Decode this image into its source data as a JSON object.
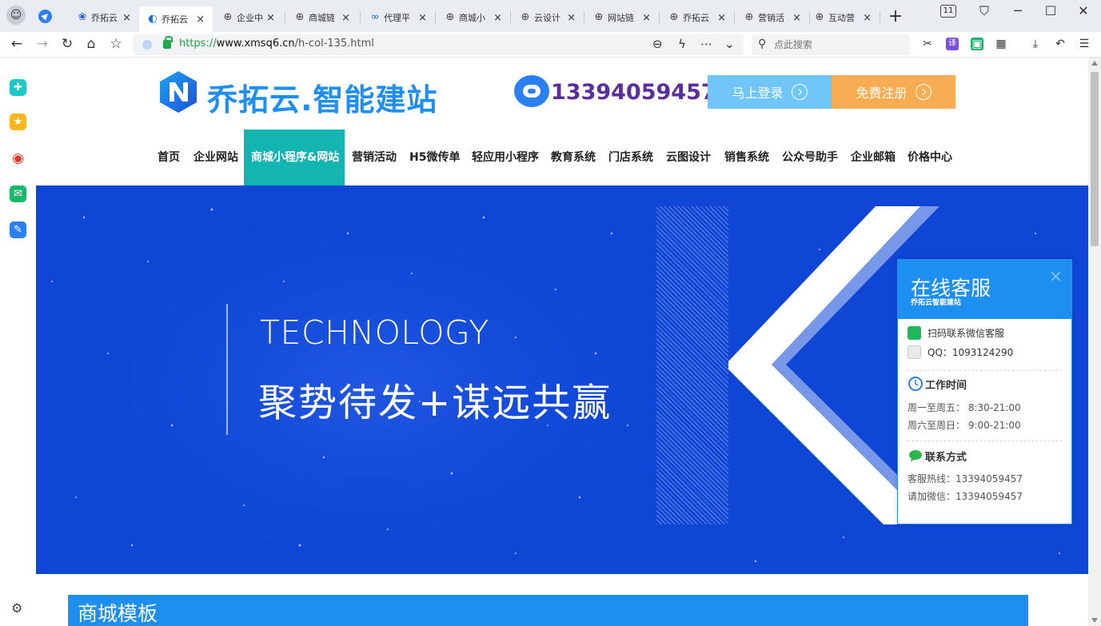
{
  "browser": {
    "tabs": [
      {
        "title": "乔拓云",
        "icon": "paw-icon"
      },
      {
        "title": "乔拓云",
        "icon": "qiaotuo-icon",
        "active": true
      },
      {
        "title": "企业中",
        "icon": "globe-icon"
      },
      {
        "title": "商城链",
        "icon": "globe-icon"
      },
      {
        "title": "代理平",
        "icon": "meta-icon"
      },
      {
        "title": "商城小",
        "icon": "globe-icon"
      },
      {
        "title": "云设计",
        "icon": "globe-icon"
      },
      {
        "title": "网站链",
        "icon": "globe-icon"
      },
      {
        "title": "乔拓云",
        "icon": "globe-icon"
      },
      {
        "title": "营销活",
        "icon": "globe-icon"
      },
      {
        "title": "互动营",
        "icon": "globe-icon"
      }
    ],
    "tab_close": "×",
    "new_tab": "+",
    "tab_count": "11",
    "url": {
      "scheme": "https://",
      "host": "www.xmsq6.cn",
      "path": "/h-col-135.html"
    },
    "search_placeholder": "点此搜索"
  },
  "header": {
    "logo_text": "乔拓云.智能建站",
    "hotline": "13394059457",
    "login_label": "马上登录",
    "register_label": "免费注册"
  },
  "nav": {
    "items": [
      "首页",
      "企业网站",
      "商城小程序&网站",
      "营销活动",
      "H5微传单",
      "轻应用小程序",
      "教育系统",
      "门店系统",
      "云图设计",
      "销售系统",
      "公众号助手",
      "企业邮箱",
      "价格中心"
    ],
    "active_index": 2
  },
  "banner": {
    "en": "TECHNOLOGY",
    "cn": "聚势待发+谋远共赢"
  },
  "service_panel": {
    "title": "在线客服",
    "subtitle": "乔拓云智能建站",
    "close": "×",
    "wechat_label": "扫码联系微信客服",
    "qq_label": "QQ：1093124290",
    "work_time_title": "工作时间",
    "weekday_hours": "周一至周五： 8:30-21:00",
    "weekend_hours": "周六至周日： 9:00-21:00",
    "contact_title": "联系方式",
    "hotline": "客服热线：13394059457",
    "wechat": "请加微信：13394059457"
  },
  "section": {
    "title": "商城模板"
  },
  "colors": {
    "brand_blue": "#1d8ff1",
    "nav_active": "#14b5b0",
    "banner_bg": "#0f46d6",
    "login_btn": "#70c6f8",
    "register_btn": "#f9ad52"
  }
}
